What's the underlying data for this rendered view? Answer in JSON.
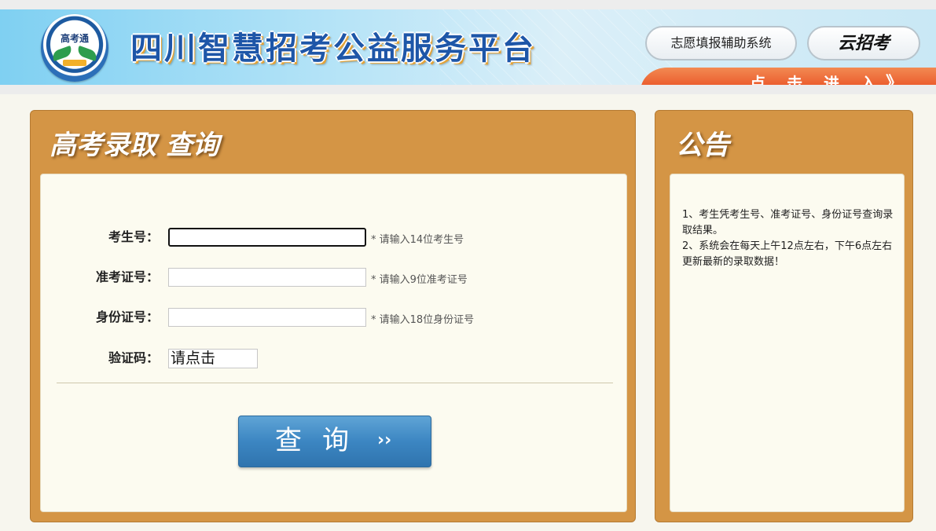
{
  "header": {
    "logo_text": "高考通",
    "site_title": "四川智慧招考公益服务平台",
    "assist_button": "志愿填报辅助系统",
    "brand_button": "云招考",
    "enter_label": "点 击 进 入",
    "enter_arrow": "》"
  },
  "query_panel": {
    "title": "高考录取 查询",
    "fields": [
      {
        "label": "考生号：",
        "value": "",
        "hint": "* 请输入14位考生号"
      },
      {
        "label": "准考证号：",
        "value": "",
        "hint": "* 请输入9位准考证号"
      },
      {
        "label": "身份证号：",
        "value": "",
        "hint": "* 请输入18位身份证号"
      }
    ],
    "captcha": {
      "label": "验证码：",
      "value": "请点击"
    },
    "submit": {
      "label": "查询",
      "arrow": "››"
    }
  },
  "notice_panel": {
    "title": "公告",
    "items": [
      "1、考生凭考生号、准考证号、身份证号查询录取结果。",
      "2、系统会在每天上午12点左右，下午6点左右更新最新的录取数据！"
    ]
  },
  "colors": {
    "panel_frame": "#d49545",
    "panel_body": "#fcfbf0",
    "title_blue": "#1e56a8",
    "enter_band": "#e8461c",
    "button_blue": "#3c86c2"
  },
  "icons": {
    "logo": "school-emblem-icon",
    "enter_arrow": "double-chevron-right-icon",
    "submit_arrow": "double-chevron-right-icon"
  }
}
